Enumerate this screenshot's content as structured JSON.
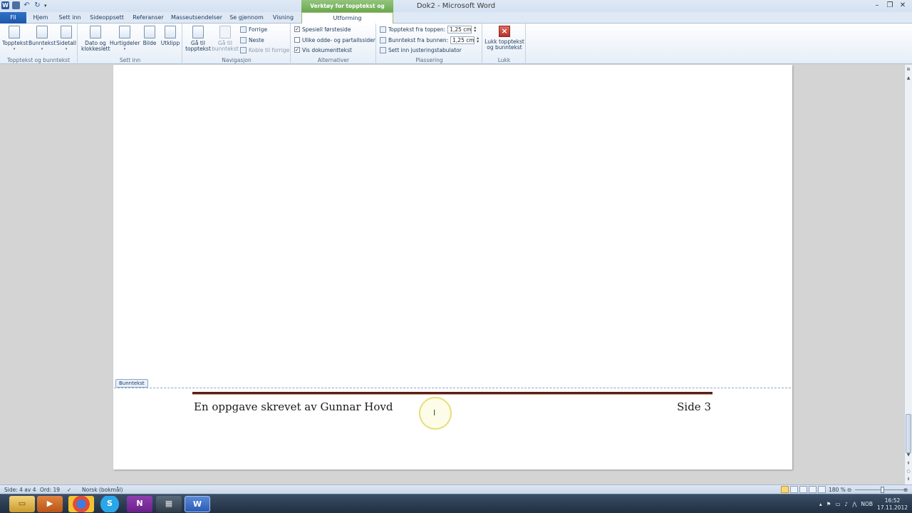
{
  "title_bar": {
    "window_title": "Dok2 - Microsoft Word",
    "contextual_tools": "Verktøy for topptekst og bunntekst",
    "quick_access": [
      "W",
      "save",
      "undo",
      "redo"
    ]
  },
  "tabs": [
    "Fil",
    "Hjem",
    "Sett inn",
    "Sideoppsett",
    "Referanser",
    "Masseutsendelser",
    "Se gjennom",
    "Visning",
    "Utforming"
  ],
  "ribbon": {
    "group_hf": {
      "label": "Topptekst og bunntekst",
      "buttons": [
        "Topptekst",
        "Bunntekst",
        "Sidetall"
      ]
    },
    "group_insert": {
      "label": "Sett inn",
      "date_line1": "Dato og",
      "date_line2": "klokkeslett",
      "quick_parts": "Hurtigdeler",
      "picture": "Bilde",
      "clip_art": "Utklipp"
    },
    "group_nav": {
      "label": "Navigasjon",
      "goto_header_1": "Gå til",
      "goto_header_2": "topptekst",
      "goto_footer_1": "Gå til",
      "goto_footer_2": "bunntekst",
      "previous": "Forrige",
      "next": "Neste",
      "link_previous": "Koble til forrige"
    },
    "group_options": {
      "label": "Alternativer",
      "different_first": "Spesiell førsteside",
      "odd_even": "Ulike odde- og partallssider",
      "show_text": "Vis dokumenttekst",
      "checks": [
        "✓",
        "",
        "✓"
      ]
    },
    "group_position": {
      "label": "Plassering",
      "header_from_top": "Topptekst fra toppen:",
      "header_value": "1,25 cm",
      "footer_from_bottom": "Bunntekst fra bunnen:",
      "footer_value": "1,25 cm",
      "align_tab": "Sett inn justeringstabulator"
    },
    "group_close": {
      "label": "Lukk",
      "close_line1": "Lukk topptekst",
      "close_line2": "og bunntekst"
    }
  },
  "document": {
    "footer_tag": "Bunntekst",
    "footer_text": "En oppgave skrevet av Gunnar Hovd",
    "page_number": "Side 3"
  },
  "status_bar": {
    "page": "Side: 4 av 4",
    "words": "Ord: 19",
    "language": "Norsk (bokmål)",
    "zoom": "180 %"
  },
  "taskbar": {
    "tray_lang": "NOB",
    "time": "16:52",
    "date": "17.11.2012"
  },
  "colors": {
    "file_tab": "#1d58a9",
    "contextual": "#6aa84f",
    "footer_rule": "#5a1d17"
  }
}
